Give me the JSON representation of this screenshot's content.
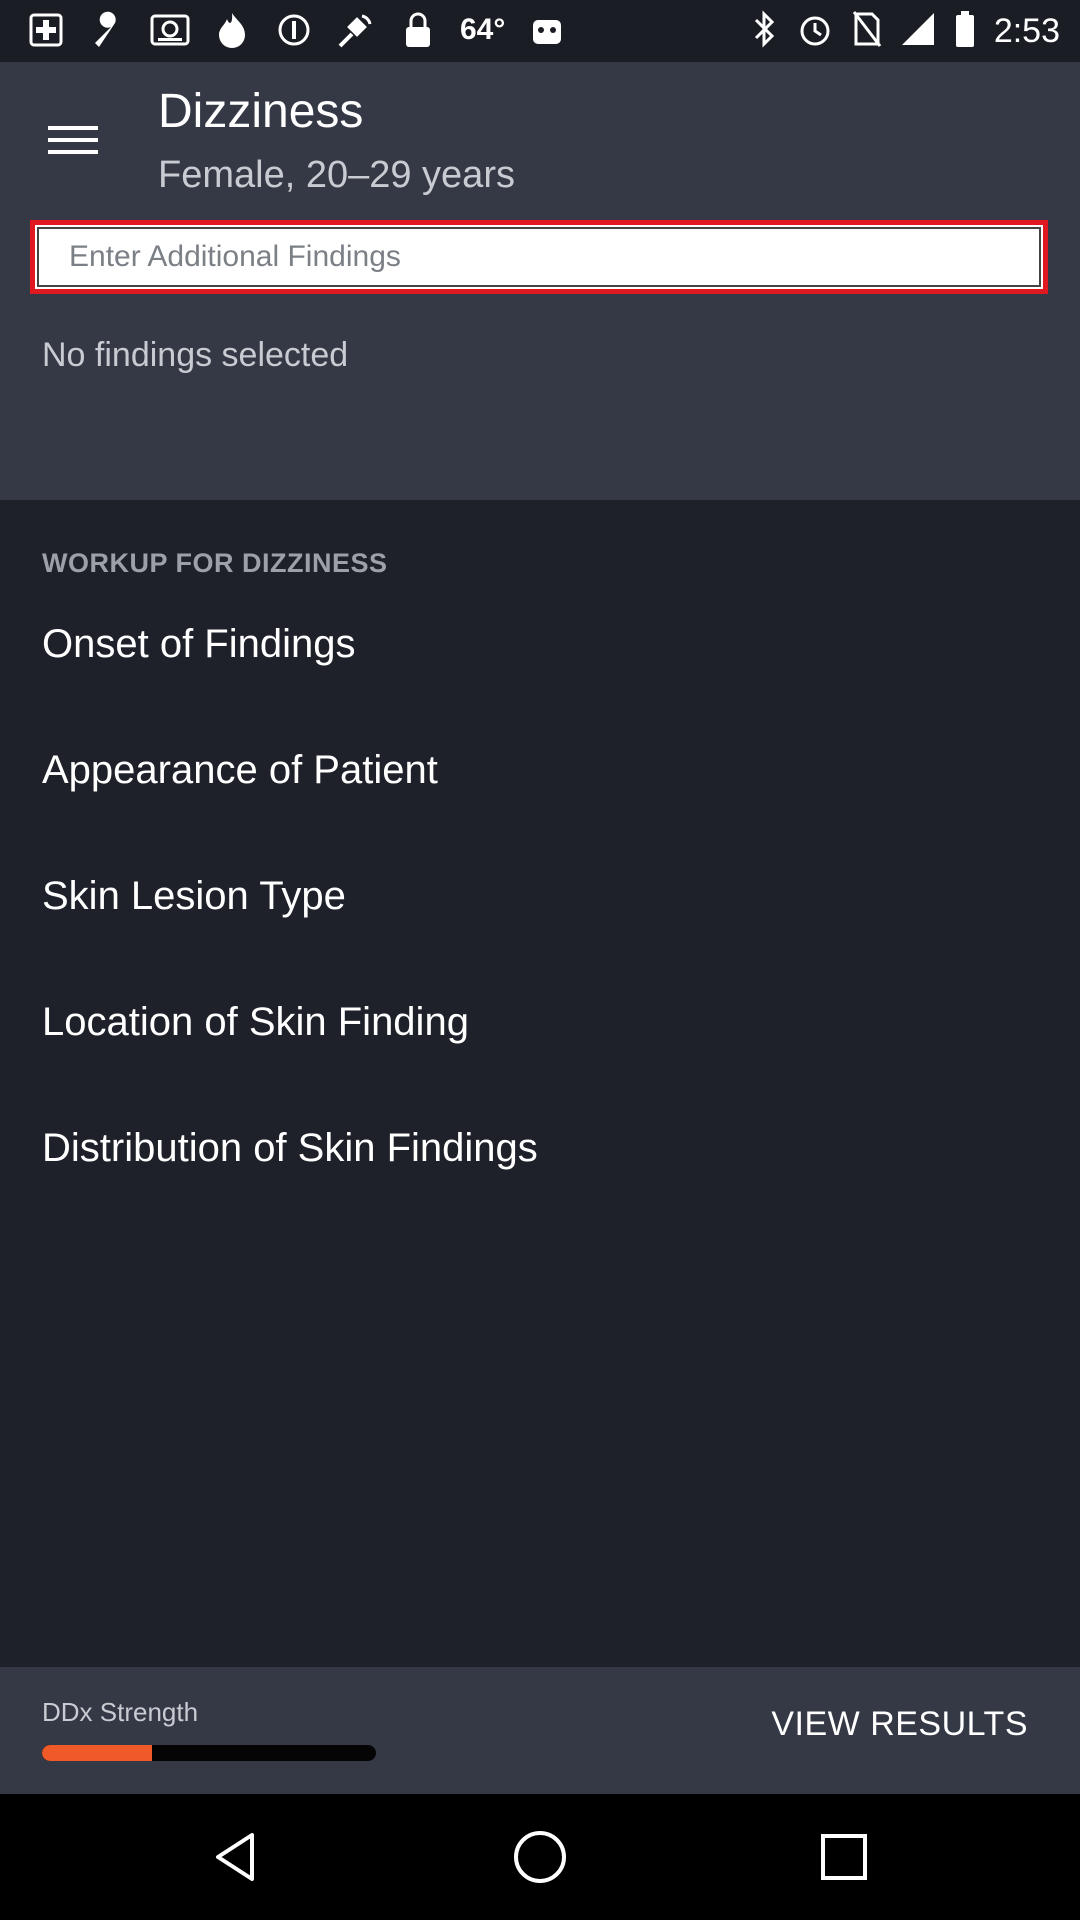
{
  "status_bar": {
    "temperature": "64°",
    "time": "2:53"
  },
  "header": {
    "title": "Dizziness",
    "subtitle": "Female, 20–29 years",
    "search_placeholder": "Enter Additional Findings",
    "empty_text": "No findings selected"
  },
  "workup": {
    "heading": "WORKUP FOR DIZZINESS",
    "items": [
      {
        "label": "Onset of Findings"
      },
      {
        "label": "Appearance of Patient"
      },
      {
        "label": "Skin Lesion Type"
      },
      {
        "label": "Location of Skin Finding"
      },
      {
        "label": "Distribution of Skin Findings"
      }
    ]
  },
  "bottom_bar": {
    "strength_label": "DDx Strength",
    "strength_fraction": 0.33,
    "strength_color": "#f05a28",
    "view_results_label": "VIEW RESULTS"
  },
  "colors": {
    "header_bg": "#353945",
    "body_bg": "#1e2129",
    "search_border": "#e01820"
  }
}
